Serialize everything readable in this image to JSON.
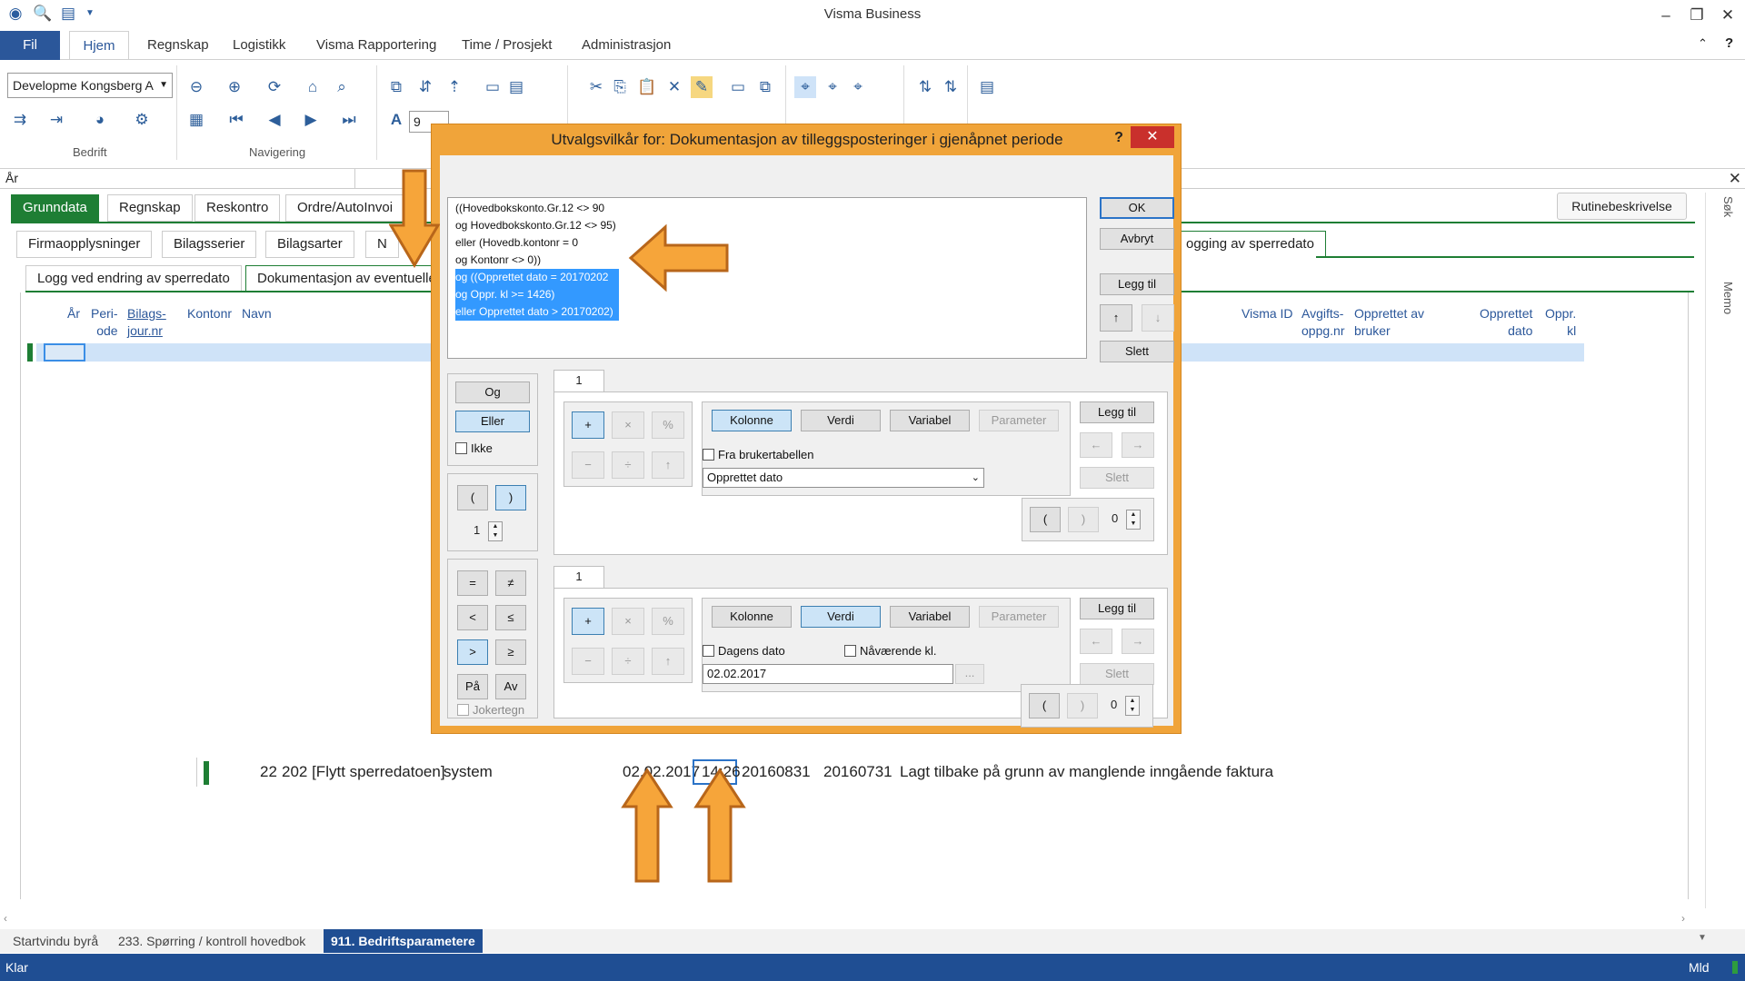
{
  "window": {
    "title": "Visma Business"
  },
  "menu_tabs": [
    "Fil",
    "Hjem",
    "Regnskap",
    "Logistikk",
    "Visma Rapportering",
    "Time / Prosjekt",
    "Administrasjon"
  ],
  "ribbon": {
    "company": "Developme Kongsberg A",
    "group_bedrift": "Bedrift",
    "group_navigering": "Navigering",
    "font_size": "9"
  },
  "field_row": {
    "label": "År"
  },
  "main_tabs": [
    "Grunndata",
    "Regnskap",
    "Reskontro",
    "Ordre/AutoInvoi"
  ],
  "sub_tabs": [
    "Firmaopplysninger",
    "Bilagsserier",
    "Bilagsarter",
    "N"
  ],
  "inner_tabs": {
    "left1": "Logg ved endring av sperredato",
    "left2": "Dokumentasjon av eventuelle",
    "right": "ogging av sperredato"
  },
  "rutine_button": "Rutinebeskrivelse",
  "side_labels": {
    "search": "Søk",
    "memo": "Memo"
  },
  "columns_left": {
    "year": "År",
    "period": "Peri-\node",
    "journal": "Bilags-\njour.nr",
    "account": "Kontonr",
    "name": "Navn"
  },
  "columns_right": {
    "visma_id": "Visma ID",
    "tax": "Avgifts-\noppg.nr",
    "created_by": "Opprettet av\nbruker",
    "created_date": "Opprettet\ndato",
    "created_time": "Oppr.\nkl"
  },
  "result_row": {
    "number": "22",
    "text": "202 [Flytt sperredatoen]",
    "user": "system",
    "date": "02.02.2017",
    "time": "14:26",
    "date2": "20160831",
    "date3": "20160731",
    "description": "Lagt tilbake på grunn av manglende inngående faktura"
  },
  "doc_tabs": [
    "Startvindu byrå",
    "233. Spørring / kontroll hovedbok",
    "911. Bedriftsparametere"
  ],
  "status": {
    "left": "Klar",
    "right": "Mld"
  },
  "dialog": {
    "title": "Utvalgsvilkår for: Dokumentasjon av tilleggsposteringer i gjenåpnet periode",
    "help": "?",
    "criteria": [
      "((Hovedbokskonto.Gr.12 <> 90",
      "og Hovedbokskonto.Gr.12 <> 95)",
      "eller (Hovedb.kontonr = 0",
      "og Kontonr <> 0))",
      "og ((Opprettet dato = 20170202",
      "og Oppr. kl >= 1426)",
      "eller Opprettet dato > 20170202)"
    ],
    "buttons": {
      "ok": "OK",
      "cancel": "Avbryt",
      "add": "Legg til",
      "up": "↑",
      "down": "↓",
      "delete": "Slett"
    },
    "logic": {
      "and": "Og",
      "or": "Eller",
      "not": "Ikke"
    },
    "parens": {
      "open": "(",
      "close": ")",
      "count": "1"
    },
    "operators": [
      "=",
      "≠",
      "<",
      "≤",
      ">",
      "≥",
      "På",
      "Av"
    ],
    "wildcard": "Jokertegn",
    "arith": [
      "+",
      "×",
      "%",
      "−",
      "÷",
      "↑"
    ],
    "panel1": {
      "tab": "1",
      "modes": [
        "Kolonne",
        "Verdi",
        "Variabel",
        "Parameter"
      ],
      "checkbox": "Fra brukertabellen",
      "value": "Opprettet dato",
      "add": "Legg til",
      "delete": "Slett",
      "paren_count": "0"
    },
    "panel2": {
      "tab": "1",
      "modes": [
        "Kolonne",
        "Verdi",
        "Variabel",
        "Parameter"
      ],
      "checkbox1": "Dagens dato",
      "checkbox2": "Nåværende kl.",
      "value": "02.02.2017",
      "ellipsis": "...",
      "add": "Legg til",
      "delete": "Slett",
      "paren_count": "0"
    }
  },
  "colors": {
    "accent": "#2b579a",
    "dialog_border": "#f0a43a",
    "highlight": "#3399ff",
    "arrow": "#f6a53a",
    "green_tab": "#1e7e34"
  }
}
